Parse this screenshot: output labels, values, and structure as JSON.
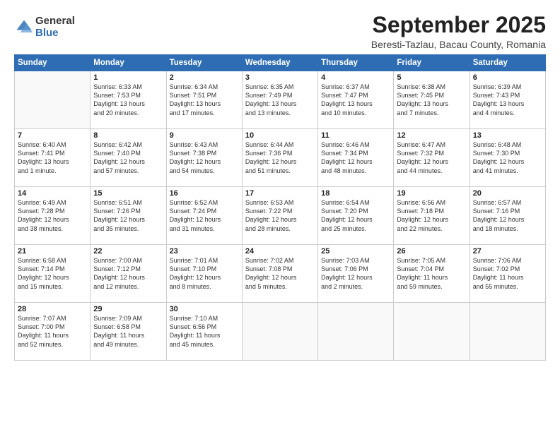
{
  "logo": {
    "general": "General",
    "blue": "Blue"
  },
  "header": {
    "month": "September 2025",
    "location": "Beresti-Tazlau, Bacau County, Romania"
  },
  "weekdays": [
    "Sunday",
    "Monday",
    "Tuesday",
    "Wednesday",
    "Thursday",
    "Friday",
    "Saturday"
  ],
  "weeks": [
    [
      {
        "day": "",
        "text": ""
      },
      {
        "day": "1",
        "text": "Sunrise: 6:33 AM\nSunset: 7:53 PM\nDaylight: 13 hours\nand 20 minutes."
      },
      {
        "day": "2",
        "text": "Sunrise: 6:34 AM\nSunset: 7:51 PM\nDaylight: 13 hours\nand 17 minutes."
      },
      {
        "day": "3",
        "text": "Sunrise: 6:35 AM\nSunset: 7:49 PM\nDaylight: 13 hours\nand 13 minutes."
      },
      {
        "day": "4",
        "text": "Sunrise: 6:37 AM\nSunset: 7:47 PM\nDaylight: 13 hours\nand 10 minutes."
      },
      {
        "day": "5",
        "text": "Sunrise: 6:38 AM\nSunset: 7:45 PM\nDaylight: 13 hours\nand 7 minutes."
      },
      {
        "day": "6",
        "text": "Sunrise: 6:39 AM\nSunset: 7:43 PM\nDaylight: 13 hours\nand 4 minutes."
      }
    ],
    [
      {
        "day": "7",
        "text": "Sunrise: 6:40 AM\nSunset: 7:41 PM\nDaylight: 13 hours\nand 1 minute."
      },
      {
        "day": "8",
        "text": "Sunrise: 6:42 AM\nSunset: 7:40 PM\nDaylight: 12 hours\nand 57 minutes."
      },
      {
        "day": "9",
        "text": "Sunrise: 6:43 AM\nSunset: 7:38 PM\nDaylight: 12 hours\nand 54 minutes."
      },
      {
        "day": "10",
        "text": "Sunrise: 6:44 AM\nSunset: 7:36 PM\nDaylight: 12 hours\nand 51 minutes."
      },
      {
        "day": "11",
        "text": "Sunrise: 6:46 AM\nSunset: 7:34 PM\nDaylight: 12 hours\nand 48 minutes."
      },
      {
        "day": "12",
        "text": "Sunrise: 6:47 AM\nSunset: 7:32 PM\nDaylight: 12 hours\nand 44 minutes."
      },
      {
        "day": "13",
        "text": "Sunrise: 6:48 AM\nSunset: 7:30 PM\nDaylight: 12 hours\nand 41 minutes."
      }
    ],
    [
      {
        "day": "14",
        "text": "Sunrise: 6:49 AM\nSunset: 7:28 PM\nDaylight: 12 hours\nand 38 minutes."
      },
      {
        "day": "15",
        "text": "Sunrise: 6:51 AM\nSunset: 7:26 PM\nDaylight: 12 hours\nand 35 minutes."
      },
      {
        "day": "16",
        "text": "Sunrise: 6:52 AM\nSunset: 7:24 PM\nDaylight: 12 hours\nand 31 minutes."
      },
      {
        "day": "17",
        "text": "Sunrise: 6:53 AM\nSunset: 7:22 PM\nDaylight: 12 hours\nand 28 minutes."
      },
      {
        "day": "18",
        "text": "Sunrise: 6:54 AM\nSunset: 7:20 PM\nDaylight: 12 hours\nand 25 minutes."
      },
      {
        "day": "19",
        "text": "Sunrise: 6:56 AM\nSunset: 7:18 PM\nDaylight: 12 hours\nand 22 minutes."
      },
      {
        "day": "20",
        "text": "Sunrise: 6:57 AM\nSunset: 7:16 PM\nDaylight: 12 hours\nand 18 minutes."
      }
    ],
    [
      {
        "day": "21",
        "text": "Sunrise: 6:58 AM\nSunset: 7:14 PM\nDaylight: 12 hours\nand 15 minutes."
      },
      {
        "day": "22",
        "text": "Sunrise: 7:00 AM\nSunset: 7:12 PM\nDaylight: 12 hours\nand 12 minutes."
      },
      {
        "day": "23",
        "text": "Sunrise: 7:01 AM\nSunset: 7:10 PM\nDaylight: 12 hours\nand 8 minutes."
      },
      {
        "day": "24",
        "text": "Sunrise: 7:02 AM\nSunset: 7:08 PM\nDaylight: 12 hours\nand 5 minutes."
      },
      {
        "day": "25",
        "text": "Sunrise: 7:03 AM\nSunset: 7:06 PM\nDaylight: 12 hours\nand 2 minutes."
      },
      {
        "day": "26",
        "text": "Sunrise: 7:05 AM\nSunset: 7:04 PM\nDaylight: 11 hours\nand 59 minutes."
      },
      {
        "day": "27",
        "text": "Sunrise: 7:06 AM\nSunset: 7:02 PM\nDaylight: 11 hours\nand 55 minutes."
      }
    ],
    [
      {
        "day": "28",
        "text": "Sunrise: 7:07 AM\nSunset: 7:00 PM\nDaylight: 11 hours\nand 52 minutes."
      },
      {
        "day": "29",
        "text": "Sunrise: 7:09 AM\nSunset: 6:58 PM\nDaylight: 11 hours\nand 49 minutes."
      },
      {
        "day": "30",
        "text": "Sunrise: 7:10 AM\nSunset: 6:56 PM\nDaylight: 11 hours\nand 45 minutes."
      },
      {
        "day": "",
        "text": ""
      },
      {
        "day": "",
        "text": ""
      },
      {
        "day": "",
        "text": ""
      },
      {
        "day": "",
        "text": ""
      }
    ]
  ]
}
